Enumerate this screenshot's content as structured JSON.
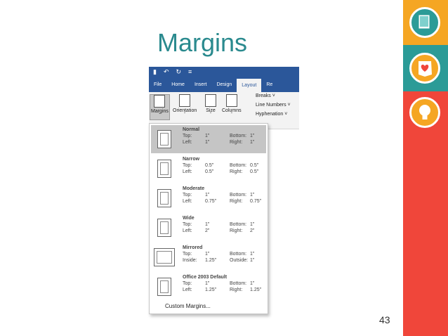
{
  "slide": {
    "title": "Margins",
    "page_number": "43"
  },
  "ribbon": {
    "tabs": [
      "File",
      "Home",
      "Insert",
      "Design",
      "Layout",
      "Re"
    ],
    "active_tab": "Layout",
    "buttons": {
      "margins": "Margins",
      "orientation": "Orientation",
      "size": "Size",
      "columns": "Columns",
      "breaks": "Breaks ˅",
      "line_numbers": "Line Numbers ˅",
      "hyphenation": "Hyphenation ˅"
    }
  },
  "menu": {
    "items": [
      {
        "name": "Normal",
        "k1": "Top:",
        "v1": "1\"",
        "k2": "Bottom:",
        "v2": "1\"",
        "k3": "Left:",
        "v3": "1\"",
        "k4": "Right:",
        "v4": "1\""
      },
      {
        "name": "Narrow",
        "k1": "Top:",
        "v1": "0.5\"",
        "k2": "Bottom:",
        "v2": "0.5\"",
        "k3": "Left:",
        "v3": "0.5\"",
        "k4": "Right:",
        "v4": "0.5\""
      },
      {
        "name": "Moderate",
        "k1": "Top:",
        "v1": "1\"",
        "k2": "Bottom:",
        "v2": "1\"",
        "k3": "Left:",
        "v3": "0.75\"",
        "k4": "Right:",
        "v4": "0.75\""
      },
      {
        "name": "Wide",
        "k1": "Top:",
        "v1": "1\"",
        "k2": "Bottom:",
        "v2": "1\"",
        "k3": "Left:",
        "v3": "2\"",
        "k4": "Right:",
        "v4": "2\""
      },
      {
        "name": "Mirrored",
        "k1": "Top:",
        "v1": "1\"",
        "k2": "Bottom:",
        "v2": "1\"",
        "k3": "Inside:",
        "v3": "1.25\"",
        "k4": "Outside:",
        "v4": "1\""
      },
      {
        "name": "Office 2003 Default",
        "k1": "Top:",
        "v1": "1\"",
        "k2": "Bottom:",
        "v2": "1\"",
        "k3": "Left:",
        "v3": "1.25\"",
        "k4": "Right:",
        "v4": "1.25\""
      }
    ],
    "custom": "Custom Margins..."
  }
}
